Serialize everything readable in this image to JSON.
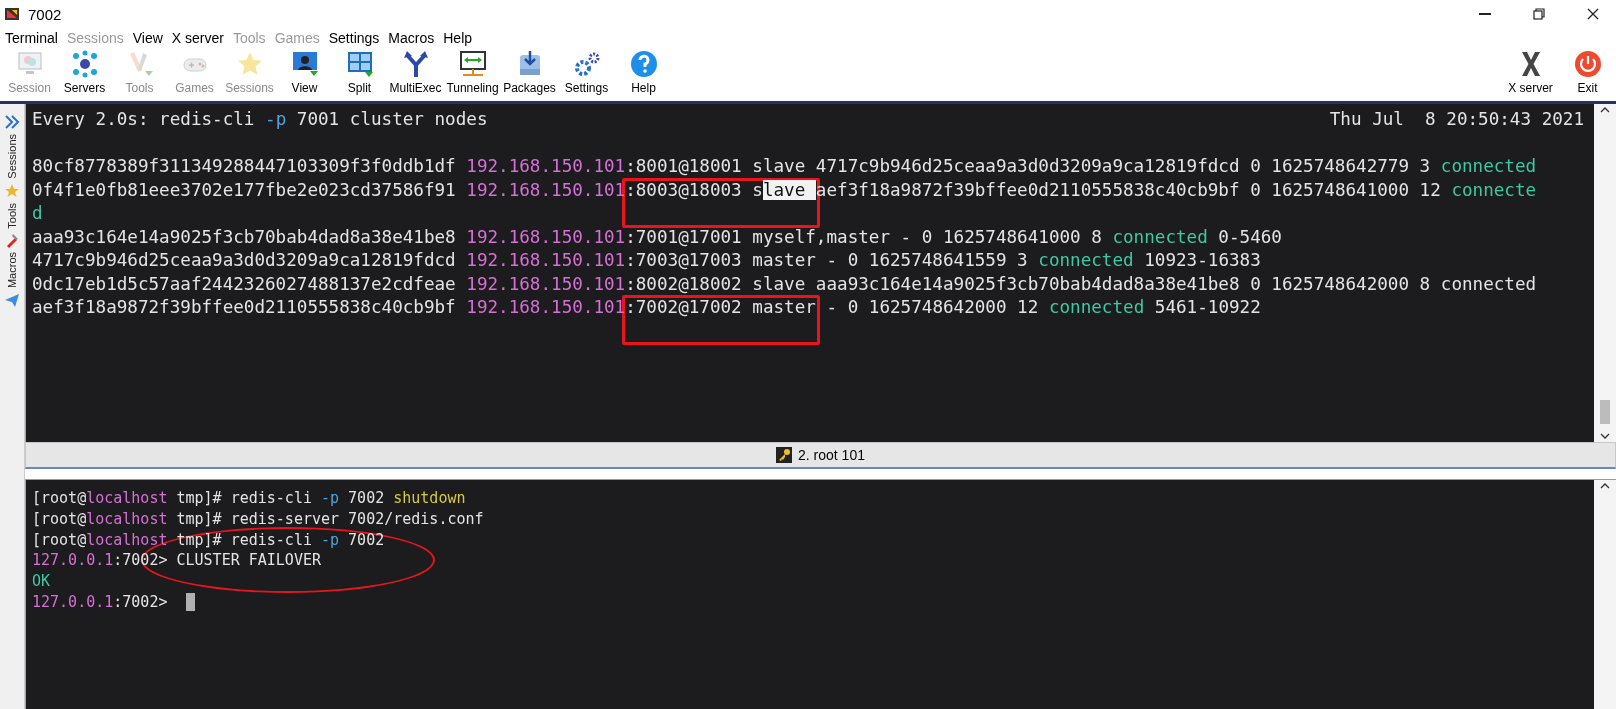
{
  "window": {
    "title": "7002"
  },
  "menu": [
    {
      "label": "Terminal",
      "disabled": false
    },
    {
      "label": "Sessions",
      "disabled": true
    },
    {
      "label": "View",
      "disabled": false
    },
    {
      "label": "X server",
      "disabled": false
    },
    {
      "label": "Tools",
      "disabled": true
    },
    {
      "label": "Games",
      "disabled": true
    },
    {
      "label": "Settings",
      "disabled": false
    },
    {
      "label": "Macros",
      "disabled": false
    },
    {
      "label": "Help",
      "disabled": false
    }
  ],
  "toolbar": [
    {
      "label": "Session",
      "disabled": true
    },
    {
      "label": "Servers",
      "disabled": false
    },
    {
      "label": "Tools",
      "disabled": true
    },
    {
      "label": "Games",
      "disabled": true
    },
    {
      "label": "Sessions",
      "disabled": true
    },
    {
      "label": "View",
      "disabled": false
    },
    {
      "label": "Split",
      "disabled": false
    },
    {
      "label": "MultiExec",
      "disabled": false
    },
    {
      "label": "Tunneling",
      "disabled": false
    },
    {
      "label": "Packages",
      "disabled": false
    },
    {
      "label": "Settings",
      "disabled": false
    },
    {
      "label": "Help",
      "disabled": false
    }
  ],
  "toolbar_right": [
    {
      "label": "X server"
    },
    {
      "label": "Exit"
    }
  ],
  "side_tabs": [
    {
      "label": "Sessions"
    },
    {
      "label": "Tools"
    },
    {
      "label": "Macros"
    }
  ],
  "top_terminal": {
    "header_left": [
      {
        "text": "Every 2.0s: redis-cli ",
        "kind": "plain"
      },
      {
        "text": "-p",
        "kind": "opt"
      },
      {
        "text": " 7001 cluster nodes",
        "kind": "plain"
      }
    ],
    "header_right": "Thu Jul  8 20:50:43 2021",
    "lines": [
      [
        {
          "text": "80cf8778389f311349288447103309f3f0ddb1df ",
          "kind": "plain"
        },
        {
          "text": "192.168.150.101",
          "kind": "ip"
        },
        {
          "text": ":8001@18001 slave 4717c9b946d25ceaa9a3d0d3209a9ca12819fdcd 0 1625748642779 3 ",
          "kind": "plain"
        },
        {
          "text": "connected",
          "kind": "ok"
        }
      ],
      [
        {
          "text": "0f4f1e0fb81eee3702e177fbe2e023cd37586f91 ",
          "kind": "plain"
        },
        {
          "text": "192.168.150.101",
          "kind": "ip"
        },
        {
          "text": ":8003@18003 s",
          "kind": "plain",
          "boxed": true
        },
        {
          "text": "lave ",
          "kind": "selected",
          "boxed": true
        },
        {
          "text": "aef3f18a9872f39bffee0d2110555838c40cb9bf 0 1625748641000 12 ",
          "kind": "plain"
        },
        {
          "text": "connecte",
          "kind": "ok"
        }
      ],
      [
        {
          "text": "d",
          "kind": "ok"
        }
      ],
      [
        {
          "text": "aaa93c164e14a9025f3cb70bab4dad8a38e41be8 ",
          "kind": "plain"
        },
        {
          "text": "192.168.150.101",
          "kind": "ip"
        },
        {
          "text": ":7001@17001 myself,master - 0 1625748641000 8 ",
          "kind": "plain"
        },
        {
          "text": "connected",
          "kind": "ok"
        },
        {
          "text": " 0-5460",
          "kind": "plain"
        }
      ],
      [
        {
          "text": "4717c9b946d25ceaa9a3d0d3209a9ca12819fdcd ",
          "kind": "plain"
        },
        {
          "text": "192.168.150.101",
          "kind": "ip"
        },
        {
          "text": ":7003@17003 master - 0 1625748641559 3 ",
          "kind": "plain"
        },
        {
          "text": "connected",
          "kind": "ok"
        },
        {
          "text": " 10923-16383",
          "kind": "plain"
        }
      ],
      [
        {
          "text": "0dc17eb1d5c57aaf2442326027488137e2cdfeae ",
          "kind": "plain"
        },
        {
          "text": "192.168.150.101",
          "kind": "ip"
        },
        {
          "text": ":8002@18002 slave aaa93c164e14a9025f3cb70bab4dad8a38e41be8 0 1625748642000 8 connected",
          "kind": "plain"
        }
      ],
      [
        {
          "text": "aef3f18a9872f39bffee0d2110555838c40cb9bf ",
          "kind": "plain"
        },
        {
          "text": "192.168.150.101",
          "kind": "ip"
        },
        {
          "text": ":7002@17002 master",
          "kind": "plain",
          "boxed": true
        },
        {
          "text": " - 0 1625748642000 12 ",
          "kind": "plain"
        },
        {
          "text": "connected",
          "kind": "ok"
        },
        {
          "text": " 5461-10922",
          "kind": "plain"
        }
      ]
    ]
  },
  "status_bar": {
    "tab": "2. root 101"
  },
  "bottom_terminal": {
    "lines": [
      [
        {
          "text": "[root@",
          "kind": "plain"
        },
        {
          "text": "localhost",
          "kind": "host"
        },
        {
          "text": " tmp]# redis-cli ",
          "kind": "plain"
        },
        {
          "text": "-p",
          "kind": "opt"
        },
        {
          "text": " 7002 ",
          "kind": "plain"
        },
        {
          "text": "shutdown",
          "kind": "cmd"
        }
      ],
      [
        {
          "text": "[root@",
          "kind": "plain"
        },
        {
          "text": "localhost",
          "kind": "host"
        },
        {
          "text": " tmp]# redis-server 7002/redis.conf",
          "kind": "plain"
        }
      ],
      [
        {
          "text": "[root@",
          "kind": "plain"
        },
        {
          "text": "localhost",
          "kind": "host"
        },
        {
          "text": " tmp]# redis-cli ",
          "kind": "plain"
        },
        {
          "text": "-p",
          "kind": "opt"
        },
        {
          "text": " 7002",
          "kind": "plain"
        }
      ],
      [
        {
          "text": "127.0.0.1",
          "kind": "ip"
        },
        {
          "text": ":700",
          "kind": "plain"
        },
        {
          "text": "2> CLUSTER FAILOVER",
          "kind": "plain",
          "circled": true
        }
      ],
      [
        {
          "text": "OK",
          "kind": "ok"
        }
      ],
      [
        {
          "text": "127.0.0.1",
          "kind": "ip"
        },
        {
          "text": ":7002> ",
          "kind": "plain"
        },
        {
          "kind": "cursor"
        }
      ]
    ]
  }
}
